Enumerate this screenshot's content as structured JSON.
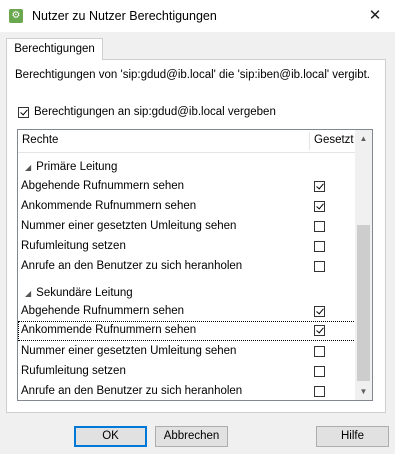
{
  "window": {
    "title": "Nutzer zu Nutzer Berechtigungen",
    "icon": "gear-icon",
    "close_glyph": "✕"
  },
  "tabs": [
    {
      "label": "Berechtigungen",
      "selected": true
    }
  ],
  "description": "Berechtigungen von 'sip:gdud@ib.local' die 'sip:iben@ib.local' vergibt.",
  "grant_checkbox": {
    "label": "Berechtigungen an sip:gdud@ib.local vergeben",
    "checked": true
  },
  "list": {
    "columns": {
      "rights": "Rechte",
      "set": "Gesetzt"
    },
    "groups": [
      {
        "title": "Primäre Leitung",
        "items": [
          {
            "label": "Abgehende Rufnummern sehen",
            "checked": true
          },
          {
            "label": "Ankommende Rufnummern sehen",
            "checked": true
          },
          {
            "label": "Nummer einer gesetzten Umleitung sehen",
            "checked": false
          },
          {
            "label": "Rufumleitung setzen",
            "checked": false
          },
          {
            "label": "Anrufe an den Benutzer zu sich heranholen",
            "checked": false
          }
        ]
      },
      {
        "title": "Sekundäre Leitung",
        "items": [
          {
            "label": "Abgehende Rufnummern sehen",
            "checked": true
          },
          {
            "label": "Ankommende Rufnummern sehen",
            "checked": true,
            "focused": true
          },
          {
            "label": "Nummer einer gesetzten Umleitung sehen",
            "checked": false
          },
          {
            "label": "Rufumleitung setzen",
            "checked": false
          },
          {
            "label": "Anrufe an den Benutzer zu sich heranholen",
            "checked": false
          }
        ]
      }
    ]
  },
  "buttons": {
    "ok": "OK",
    "cancel": "Abbrechen",
    "help": "Hilfe"
  },
  "colors": {
    "accent": "#0078d7",
    "app_icon": "#6aa84f"
  }
}
